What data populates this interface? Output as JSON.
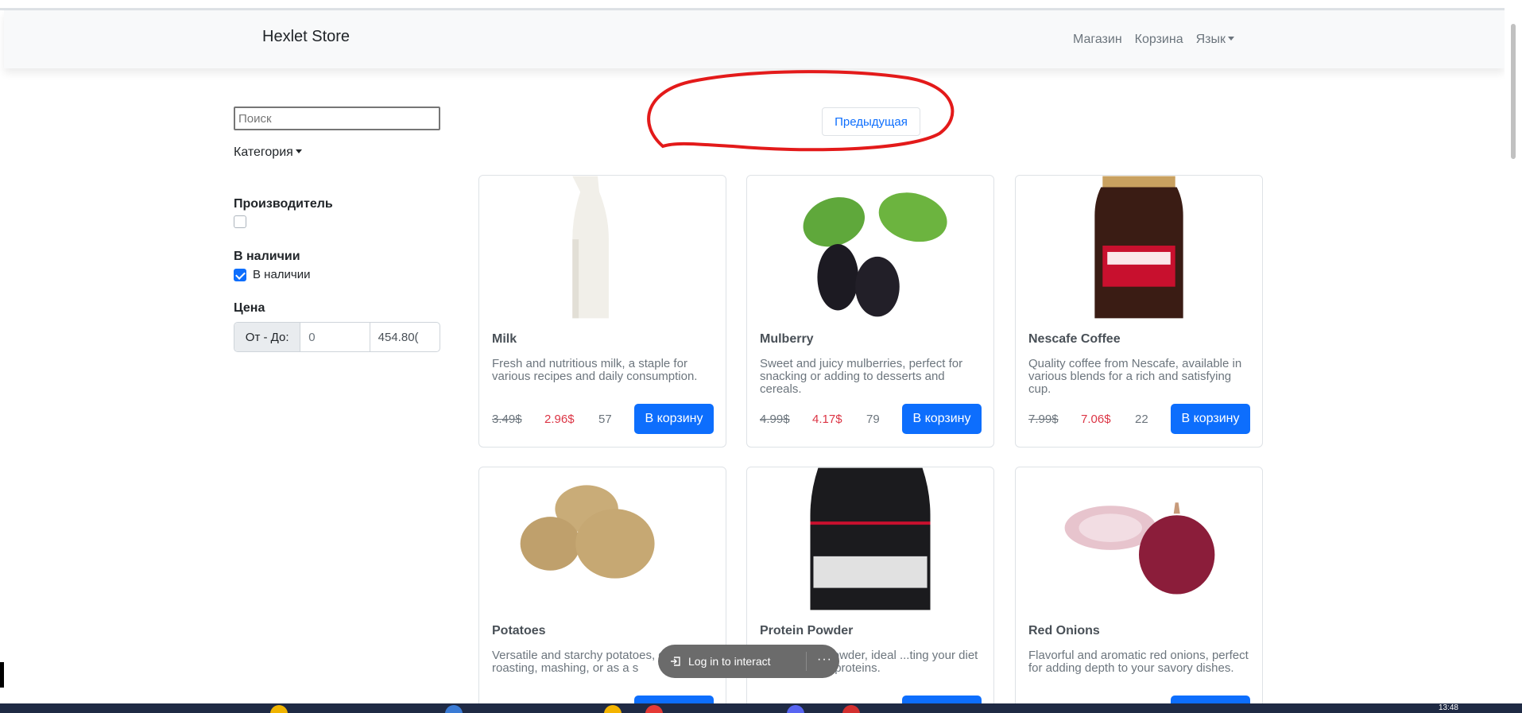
{
  "navbar": {
    "brand": "Hexlet Store",
    "links": [
      "Магазин",
      "Корзина"
    ],
    "language": "Язык"
  },
  "sidebar": {
    "search_placeholder": "Поиск",
    "category": "Категория",
    "manufacturer_label": "Производитель",
    "availability_label": "В наличии",
    "availability_option": "В наличии",
    "availability_checked": true,
    "price_label": "Цена",
    "price_prefix": "От - До:",
    "price_from": "0",
    "price_to": "454.80("
  },
  "pagination": {
    "prev_label": "Предыдущая"
  },
  "products": [
    {
      "title": "Milk",
      "description": "Fresh and nutritious milk, a staple for various recipes and daily consumption.",
      "old_price": "3.49$",
      "new_price": "2.96$",
      "stock": "57",
      "button": "В корзину"
    },
    {
      "title": "Mulberry",
      "description": "Sweet and juicy mulberries, perfect for snacking or adding to desserts and cereals.",
      "old_price": "4.99$",
      "new_price": "4.17$",
      "stock": "79",
      "button": "В корзину"
    },
    {
      "title": "Nescafe Coffee",
      "description": "Quality coffee from Nescafe, available in various blends for a rich and satisfying cup.",
      "old_price": "7.99$",
      "new_price": "7.06$",
      "stock": "22",
      "button": "В корзину"
    },
    {
      "title": "Potatoes",
      "description": "Versatile and starchy potatoes, great for roasting, mashing, or as a s",
      "old_price": "",
      "new_price": "",
      "stock": "",
      "button": ""
    },
    {
      "title": "Protein Powder",
      "description": "...ed protein powder, ideal ...ting your diet with essential proteins.",
      "old_price": "",
      "new_price": "",
      "stock": "",
      "button": ""
    },
    {
      "title": "Red Onions",
      "description": "Flavorful and aromatic red onions, perfect for adding depth to your savory dishes.",
      "old_price": "",
      "new_price": "",
      "stock": "",
      "button": ""
    }
  ],
  "overlay": {
    "login_label": "Log in to interact",
    "more": "···"
  },
  "taskbar": {
    "time": "13:48"
  },
  "colors": {
    "primary": "#0d6efd",
    "sale_price": "#dc3545",
    "navbar_bg": "#f8f9fa",
    "annotation": "#e31a1a"
  }
}
